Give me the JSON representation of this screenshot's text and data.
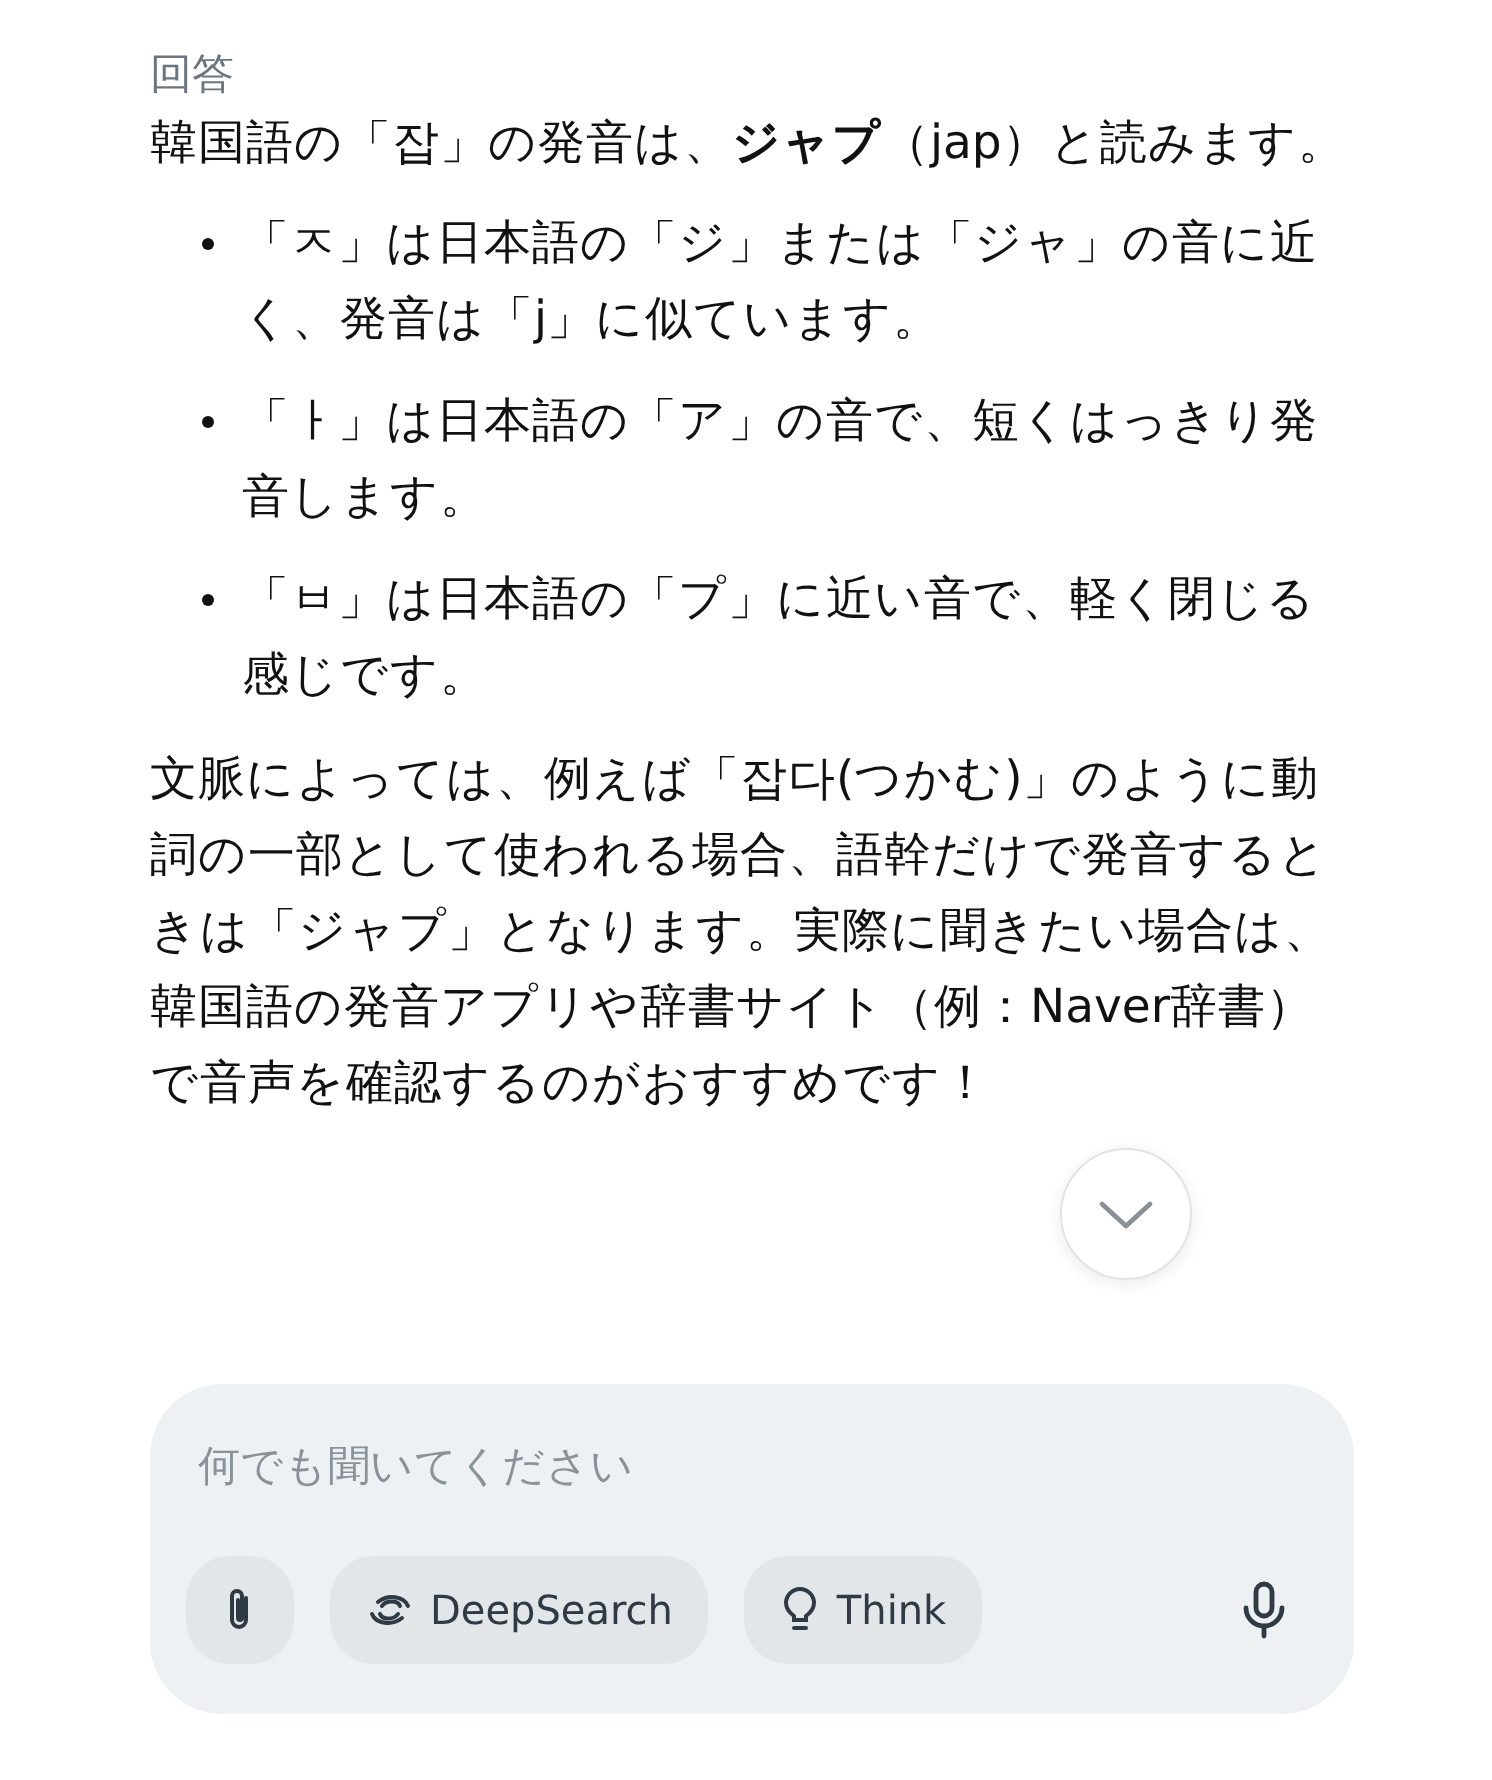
{
  "answer": {
    "label": "回答",
    "intro": "韓国語の「잡」の発音は、**ジャプ**（jap）と読みます。",
    "bullets": [
      "「ㅈ」は日本語の「ジ」または「ジャ」の音に近く、発音は「j」に似ています。",
      "「ㅏ」は日本語の「ア」の音で、短くはっきり発音します。",
      "「ㅂ」は日本語の「プ」に近い音で、軽く閉じる感じです。"
    ],
    "closing": "文脈によっては、例えば「잡다(つかむ)」のように動詞の一部として使われる場合、語幹だけで発音するときは「ジャプ」となります。実際に聞きたい場合は、韓国語の発音アプリや辞書サイト（例：Naver辞書）で音声を確認するのがおすすめです！"
  },
  "composer": {
    "placeholder": "何でも聞いてください",
    "tools": [
      {
        "kind": "attach"
      },
      {
        "kind": "deepsearch",
        "label": "DeepSearch"
      },
      {
        "kind": "think",
        "label": "Think"
      },
      {
        "kind": "mic"
      }
    ]
  }
}
